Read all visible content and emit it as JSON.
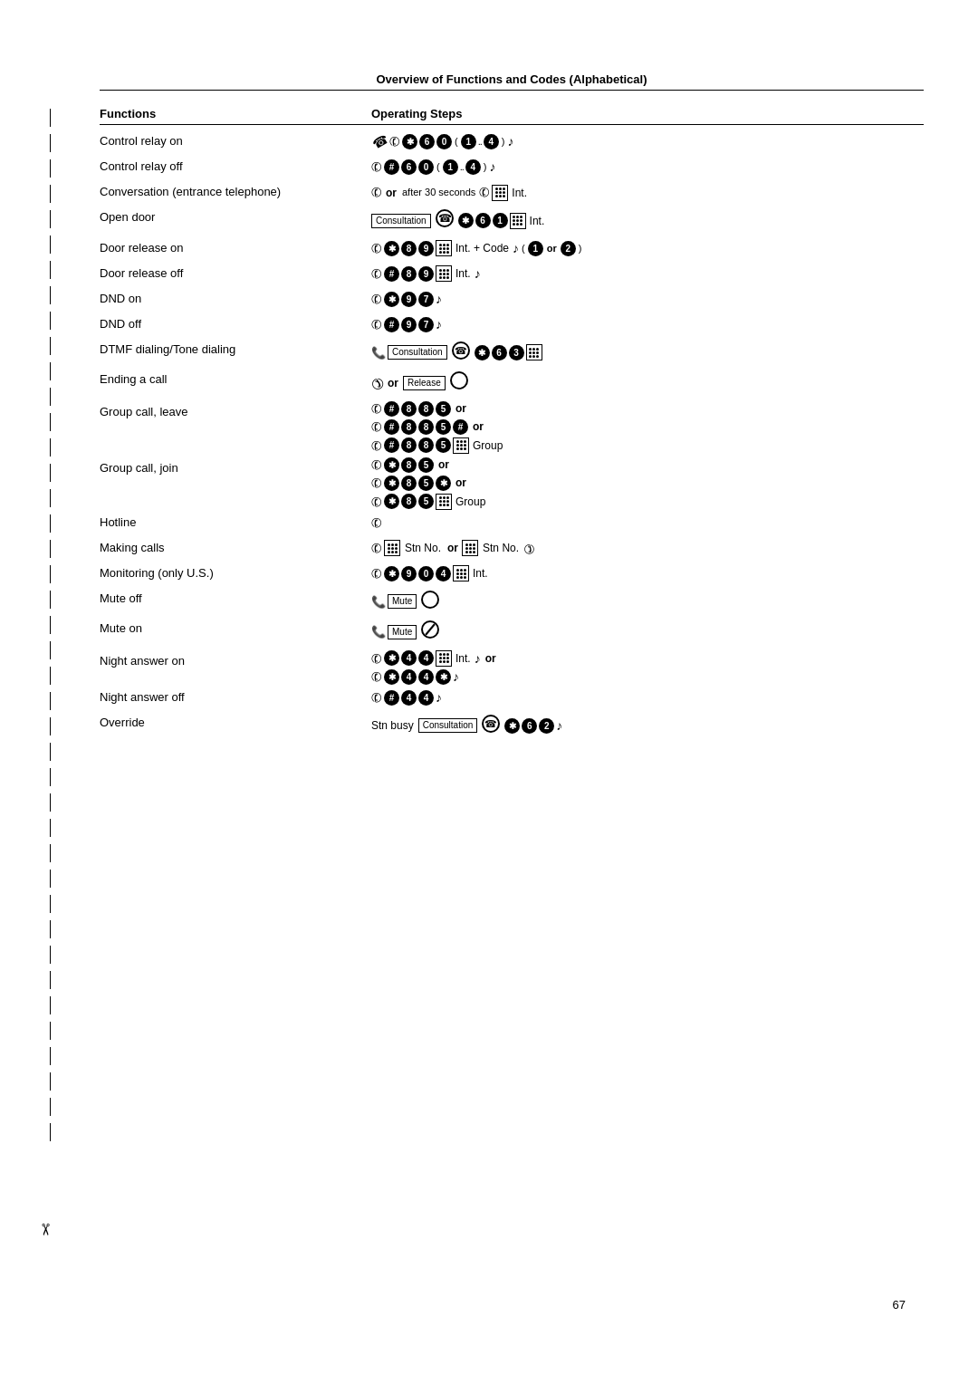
{
  "page": {
    "title": "Overview of Functions and Codes (Alphabetical)",
    "page_number": "67",
    "columns": {
      "functions": "Functions",
      "steps": "Operating Steps"
    },
    "rows": [
      {
        "func": "Control relay on",
        "steps_text": "lift * 6 0 (1..4) ring"
      },
      {
        "func": "Control relay off",
        "steps_text": "lift # 6 0 (1..4) ring"
      },
      {
        "func": "Conversation (entrance telephone)",
        "steps_text": "lift or after 30 seconds lift keypad Int."
      },
      {
        "func": "Open door",
        "steps_text": "Consultation circle * 6 1 keypad Int."
      },
      {
        "func": "Door release on",
        "steps_text": "lift * 8 9 keypad Int. + Code ring (1 or 2)"
      },
      {
        "func": "Door release off",
        "steps_text": "lift # 8 9 keypad Int. ring"
      },
      {
        "func": "DND on",
        "steps_text": "lift * 9 7 ring"
      },
      {
        "func": "DND off",
        "steps_text": "lift # 9 7 ring"
      },
      {
        "func": "DTMF dialing/Tone dialing",
        "steps_text": "handset Consultation circle * 6 3 keypad"
      },
      {
        "func": "Ending a call",
        "steps_text": "hangup or Release circle"
      },
      {
        "func": "Group call, leave",
        "steps_text": "multi"
      },
      {
        "func": "Group call, join",
        "steps_text": "multi"
      },
      {
        "func": "Hotline",
        "steps_text": "lift"
      },
      {
        "func": "Making calls",
        "steps_text": "lift keypad Stn No. or keypad Stn No. lift"
      },
      {
        "func": "Monitoring (only U.S.)",
        "steps_text": "lift * 9 0 4 keypad Int."
      },
      {
        "func": "Mute off",
        "steps_text": "handset Mute circle-open"
      },
      {
        "func": "Mute on",
        "steps_text": "handset Mute circle-slash"
      },
      {
        "func": "Night answer on",
        "steps_text": "multi"
      },
      {
        "func": "Night answer off",
        "steps_text": "lift # 4 4 ring"
      },
      {
        "func": "Override",
        "steps_text": "Stn busy Consultation circle * 6 2 ring"
      }
    ],
    "labels": {
      "consultation": "Consultation",
      "release": "Release",
      "mute": "Mute",
      "group": "Group",
      "stn_busy": "Stn busy",
      "int": "Int.",
      "or": "or",
      "after_30": "after 30 seconds",
      "code": "Code"
    }
  }
}
